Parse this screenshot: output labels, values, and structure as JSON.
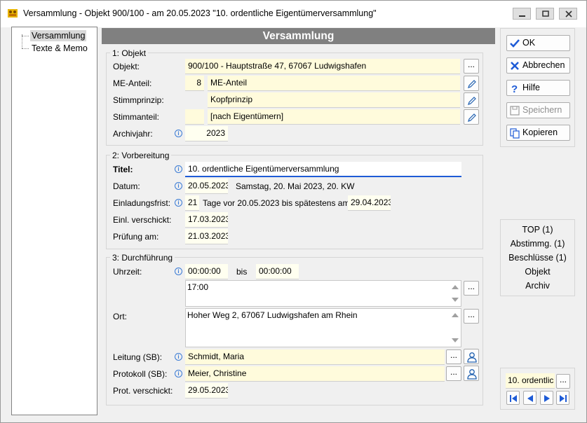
{
  "window": {
    "title": "Versammlung - Objekt 900/100 - am 20.05.2023 \"10. ordentliche Eigentümerversammlung\""
  },
  "tree": {
    "items": [
      {
        "label": "Versammlung"
      },
      {
        "label": "Texte & Memo"
      }
    ]
  },
  "header": {
    "title": "Versammlung"
  },
  "objekt": {
    "group": "1: Objekt",
    "objekt_label": "Objekt:",
    "objekt_value": "900/100 - Hauptstraße 47, 67067 Ludwigshafen",
    "me_anteil_label": "ME-Anteil:",
    "me_anteil_num": "8",
    "me_anteil_text": "ME-Anteil",
    "stimmprinzip_label": "Stimmprinzip:",
    "stimmprinzip_value": "Kopfprinzip",
    "stimmanteil_label": "Stimmanteil:",
    "stimmanteil_value": "[nach Eigentümern]",
    "archivjahr_label": "Archivjahr:",
    "archivjahr_value": "2023"
  },
  "vorbereitung": {
    "group": "2: Vorbereitung",
    "titel_label": "Titel:",
    "titel_value": "10. ordentliche Eigentümerversammlung",
    "datum_label": "Datum:",
    "datum_value": "20.05.2023",
    "datum_info": "Samstag,  20. Mai 2023,  20. KW",
    "frist_label": "Einladungsfrist:",
    "frist_days": "21",
    "frist_text": "Tage vor 20.05.2023 bis spätestens am",
    "frist_date": "29.04.2023",
    "verschickt_label": "Einl. verschickt:",
    "verschickt_value": "17.03.2023",
    "pruefung_label": "Prüfung am:",
    "pruefung_value": "21.03.2023"
  },
  "durchfuehrung": {
    "group": "3: Durchführung",
    "uhrzeit_label": "Uhrzeit:",
    "uhrzeit_from": "00:00:00",
    "bis_label": "bis",
    "uhrzeit_to": "00:00:00",
    "uhrzeit_text": "17:00",
    "ort_label": "Ort:",
    "ort_value": "Hoher Weg 2, 67067 Ludwigshafen am Rhein",
    "leitung_label": "Leitung (SB):",
    "leitung_value": "Schmidt, Maria",
    "protokoll_label": "Protokoll (SB):",
    "protokoll_value": "Meier, Christine",
    "prot_verschickt_label": "Prot. verschickt:",
    "prot_verschickt_value": "29.05.2023"
  },
  "buttons": {
    "ok": "OK",
    "abbrechen": "Abbrechen",
    "hilfe": "Hilfe",
    "speichern": "Speichern",
    "kopieren": "Kopieren",
    "dots": "..."
  },
  "links": [
    "TOP (1)",
    "Abstimmg. (1)",
    "Beschlüsse (1)",
    "Objekt",
    "Archiv"
  ],
  "navigator": {
    "current": "10. ordentlic"
  }
}
